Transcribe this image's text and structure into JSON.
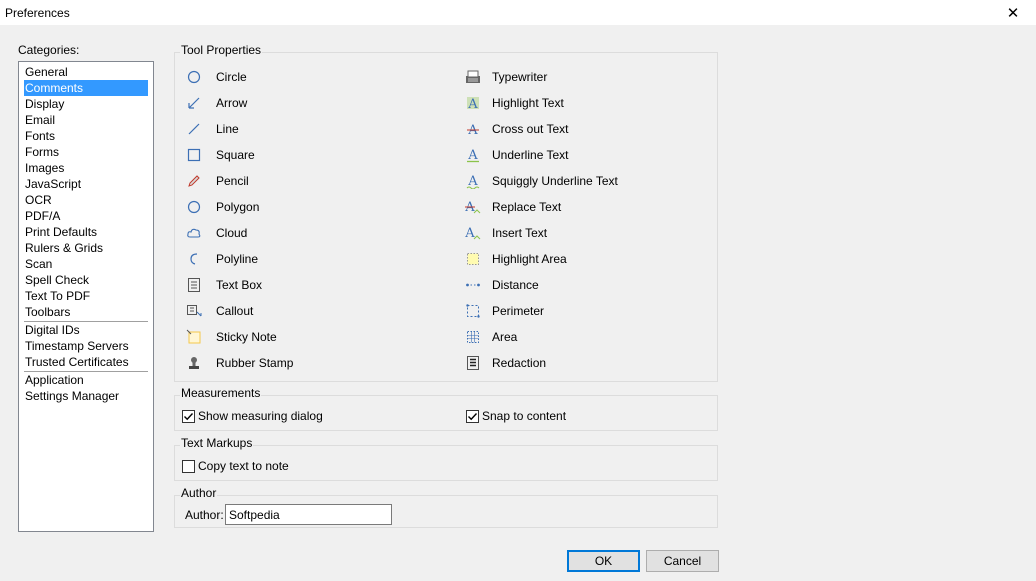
{
  "window": {
    "title": "Preferences",
    "close_glyph": "✕"
  },
  "categories": {
    "label": "Categories:",
    "items": [
      {
        "label": "General"
      },
      {
        "label": "Comments",
        "selected": true
      },
      {
        "label": "Display"
      },
      {
        "label": "Email"
      },
      {
        "label": "Fonts"
      },
      {
        "label": "Forms"
      },
      {
        "label": "Images"
      },
      {
        "label": "JavaScript"
      },
      {
        "label": "OCR"
      },
      {
        "label": "PDF/A"
      },
      {
        "label": "Print Defaults"
      },
      {
        "label": "Rulers & Grids"
      },
      {
        "label": "Scan"
      },
      {
        "label": "Spell Check"
      },
      {
        "label": "Text To PDF"
      },
      {
        "label": "Toolbars"
      },
      {
        "label": "Digital IDs"
      },
      {
        "label": "Timestamp Servers"
      },
      {
        "label": "Trusted Certificates"
      },
      {
        "label": "Application"
      },
      {
        "label": "Settings Manager"
      }
    ]
  },
  "tool_properties": {
    "title": "Tool Properties",
    "left": [
      {
        "label": "Circle",
        "icon": "circle-icon"
      },
      {
        "label": "Arrow",
        "icon": "arrow-icon"
      },
      {
        "label": "Line",
        "icon": "line-icon"
      },
      {
        "label": "Square",
        "icon": "square-icon"
      },
      {
        "label": "Pencil",
        "icon": "pencil-icon"
      },
      {
        "label": "Polygon",
        "icon": "polygon-icon"
      },
      {
        "label": "Cloud",
        "icon": "cloud-icon"
      },
      {
        "label": "Polyline",
        "icon": "polyline-icon"
      },
      {
        "label": "Text Box",
        "icon": "text-box-icon"
      },
      {
        "label": "Callout",
        "icon": "callout-icon"
      },
      {
        "label": "Sticky Note",
        "icon": "sticky-note-icon"
      },
      {
        "label": "Rubber Stamp",
        "icon": "rubber-stamp-icon"
      }
    ],
    "right": [
      {
        "label": "Typewriter",
        "icon": "typewriter-icon"
      },
      {
        "label": "Highlight Text",
        "icon": "highlight-text-icon"
      },
      {
        "label": "Cross out Text",
        "icon": "cross-out-text-icon"
      },
      {
        "label": "Underline Text",
        "icon": "underline-text-icon"
      },
      {
        "label": "Squiggly Underline Text",
        "icon": "squiggly-underline-text-icon"
      },
      {
        "label": "Replace Text",
        "icon": "replace-text-icon"
      },
      {
        "label": "Insert Text",
        "icon": "insert-text-icon"
      },
      {
        "label": "Highlight Area",
        "icon": "highlight-area-icon"
      },
      {
        "label": "Distance",
        "icon": "distance-icon"
      },
      {
        "label": "Perimeter",
        "icon": "perimeter-icon"
      },
      {
        "label": "Area",
        "icon": "area-icon"
      },
      {
        "label": "Redaction",
        "icon": "redaction-icon"
      }
    ]
  },
  "measurements": {
    "title": "Measurements",
    "show_dialog": {
      "label": "Show measuring dialog",
      "checked": true
    },
    "snap": {
      "label": "Snap to content",
      "checked": true
    }
  },
  "text_markups": {
    "title": "Text Markups",
    "copy_text": {
      "label": "Copy text to note",
      "checked": false
    }
  },
  "author": {
    "title": "Author",
    "field_label": "Author:",
    "value": "Softpedia"
  },
  "buttons": {
    "ok": "OK",
    "cancel": "Cancel"
  },
  "colors": {
    "selection": "#3399ff",
    "icon_blue": "#3c6fb4",
    "highlight_green": "#8bc34a",
    "sticky_yellow": "#f5c84c"
  }
}
